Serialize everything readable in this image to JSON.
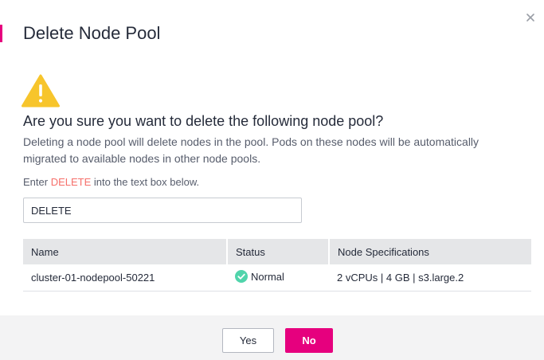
{
  "dialog": {
    "title": "Delete Node Pool",
    "close_icon": "close-icon",
    "question": "Are you sure you want to delete the following node pool?",
    "description": "Deleting a node pool will delete nodes in the pool. Pods on these nodes will be automatically migrated to available nodes in other node pools.",
    "enter_prefix": "Enter ",
    "enter_keyword": "DELETE",
    "enter_suffix": " into the text box below.",
    "input_value": "DELETE",
    "warning_icon": "warning-triangle-icon"
  },
  "table": {
    "headers": [
      "Name",
      "Status",
      "Node Specifications"
    ],
    "rows": [
      {
        "name": "cluster-01-nodepool-50221",
        "status": "Normal",
        "status_icon": "check-circle-icon",
        "spec": "2 vCPUs | 4 GB | s3.large.2"
      }
    ]
  },
  "footer": {
    "yes_label": "Yes",
    "no_label": "No"
  },
  "colors": {
    "accent": "#e6007e",
    "keyword": "#f66f6a",
    "warning": "#f7c52c",
    "success": "#50d4ab"
  }
}
